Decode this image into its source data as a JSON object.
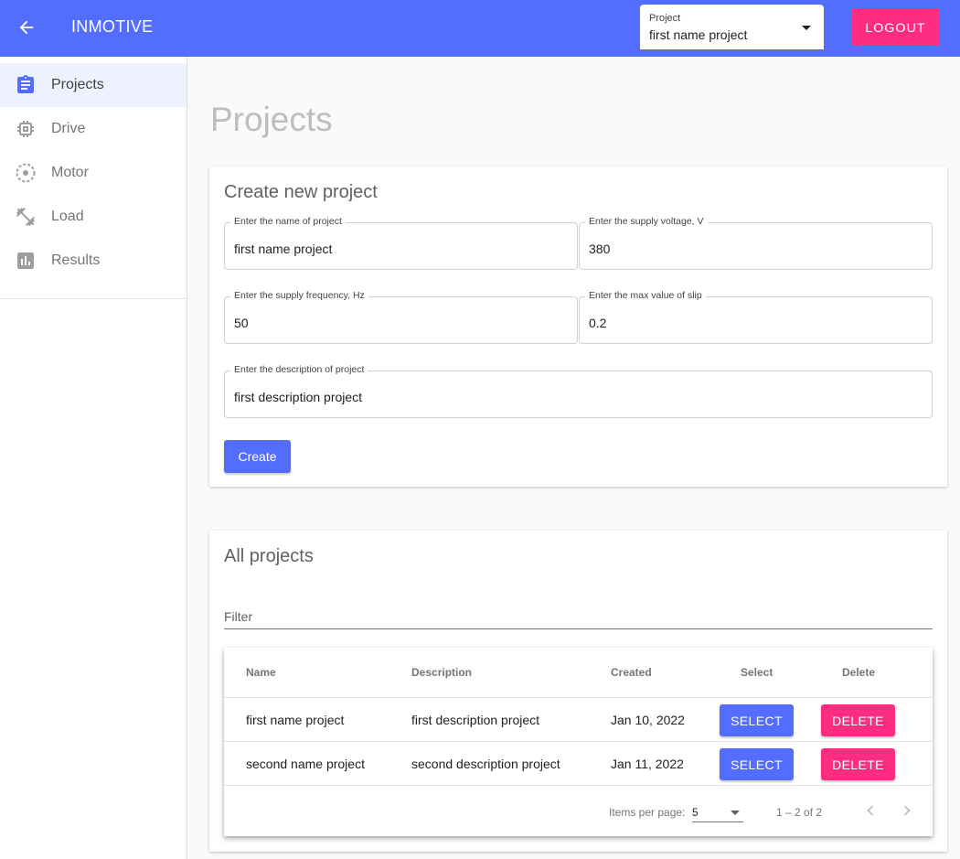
{
  "header": {
    "app_title": "INMOTIVE",
    "project_select": {
      "label": "Project",
      "value": "first name project"
    },
    "logout_label": "LOGOUT"
  },
  "sidebar": {
    "items": [
      {
        "label": "Projects",
        "icon": "clipboard-icon",
        "active": true
      },
      {
        "label": "Drive",
        "icon": "chip-icon",
        "active": false
      },
      {
        "label": "Motor",
        "icon": "motor-icon",
        "active": false
      },
      {
        "label": "Load",
        "icon": "dumbbell-icon",
        "active": false
      },
      {
        "label": "Results",
        "icon": "bar-chart-icon",
        "active": false
      }
    ]
  },
  "main": {
    "page_title": "Projects",
    "create": {
      "title": "Create new project",
      "fields": {
        "name": {
          "label": "Enter the name of project",
          "value": "first name project"
        },
        "voltage": {
          "label": "Enter the supply voltage, V",
          "value": "380"
        },
        "frequency": {
          "label": "Enter the supply frequency, Hz",
          "value": "50"
        },
        "slip": {
          "label": "Enter the max value of slip",
          "value": "0.2"
        },
        "description": {
          "label": "Enter the description of project",
          "value": "first description project"
        }
      },
      "create_label": "Create"
    },
    "all": {
      "title": "All projects",
      "filter_label": "Filter",
      "columns": {
        "name": "Name",
        "description": "Description",
        "created": "Created",
        "select": "Select",
        "delete": "Delete"
      },
      "rows": [
        {
          "name": "first name project",
          "description": "first description project",
          "created": "Jan 10, 2022",
          "select": "SELECT",
          "delete": "DELETE"
        },
        {
          "name": "second name project",
          "description": "second description project",
          "created": "Jan 11, 2022",
          "select": "SELECT",
          "delete": "DELETE"
        }
      ],
      "paginator": {
        "items_per_page_label": "Items per page:",
        "page_size": "5",
        "range": "1 – 2 of 2"
      }
    }
  },
  "colors": {
    "primary": "#536dfe",
    "accent": "#ff2d82"
  }
}
